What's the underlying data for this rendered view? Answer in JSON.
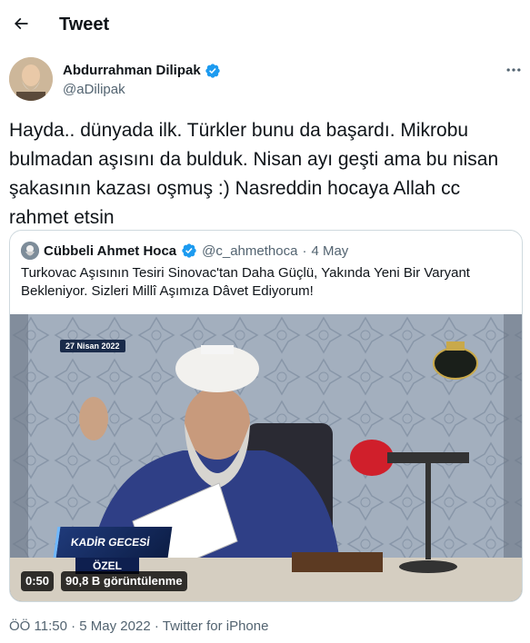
{
  "header": {
    "title": "Tweet",
    "back_icon": "arrow-left-icon"
  },
  "author": {
    "name": "Abdurrahman Dilipak",
    "handle": "@aDilipak",
    "verified_icon": "verified-badge-icon"
  },
  "tweet": {
    "text": "Hayda.. dünyada ilk. Türkler bunu da başardı. Mikrobu bulmadan aşısını da bulduk. Nisan ayı geşti ama bu nisan şakasının kazası oşmuş :) Nasreddin hocaya Allah cc rahmet etsin"
  },
  "quoted_tweet": {
    "name": "Cübbeli Ahmet Hoca",
    "handle": "@c_ahmethoca",
    "separator": "·",
    "date": "4 May",
    "text": "Turkovac Aşısının Tesiri Sinovac'tan Daha Güçlü, Yakında Yeni Bir Varyant Bekleniyor. Sizleri Millî Aşımıza Dâvet Ediyorum!",
    "video": {
      "overlay_date": "27 Nisan 2022",
      "badge_title": "KADİR GECESİ",
      "badge_subtitle": "ÖZEL",
      "duration": "0:50",
      "views": "90,8 B görüntülenme"
    }
  },
  "meta": {
    "time": "ÖÖ 11:50",
    "separator1": " · ",
    "date": "5 May 2022",
    "separator2": " · ",
    "source": "Twitter for iPhone"
  },
  "colors": {
    "text_primary": "#0f1419",
    "text_secondary": "#536471",
    "verified": "#1d9bf0",
    "border": "#cfd9de"
  }
}
